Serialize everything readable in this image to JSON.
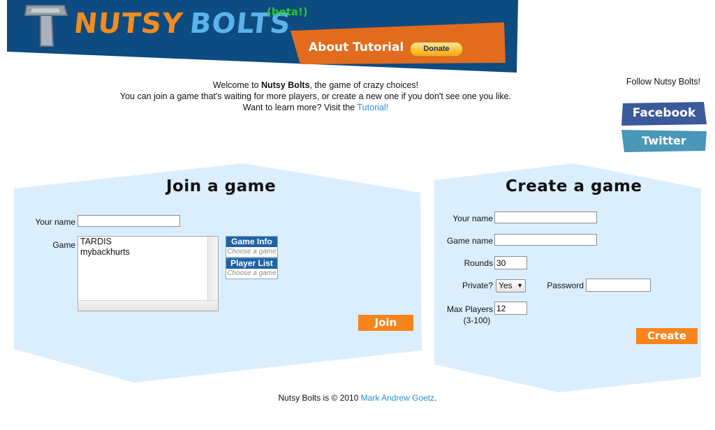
{
  "header": {
    "logo_word1": "NUTSY",
    "logo_word2": "BOLTS",
    "beta": "(beta!)",
    "about": "About",
    "tutorial": "Tutorial",
    "donate": "Donate",
    "colors": {
      "banner": "#0d4b80",
      "orange": "#e26b1d",
      "logo_orange": "#f28c1f",
      "logo_blue": "#5ab3ea"
    }
  },
  "intro": {
    "welcome_prefix": "Welcome to ",
    "brand": "Nutsy Bolts",
    "welcome_suffix": ", the game of crazy choices!",
    "line2": "You can join a game that's waiting for more players, or create a new one if you don't see one you like.",
    "line3_prefix": "Want to learn more? Visit the ",
    "tutorial_link": "Tutorial!"
  },
  "follow": {
    "label": "Follow Nutsy Bolts!",
    "facebook": "Facebook",
    "twitter": "Twitter"
  },
  "join": {
    "title": "Join a game",
    "name_label": "Your name",
    "name_value": "",
    "game_label": "Game",
    "games": [
      "TARDIS",
      "mybackhurts"
    ],
    "game_info_label": "Game Info",
    "game_info_hint": "Choose a game",
    "player_list_label": "Player List",
    "player_list_hint": "Choose a game",
    "join_button": "Join"
  },
  "create": {
    "title": "Create a game",
    "name_label": "Your name",
    "name_value": "",
    "game_name_label": "Game name",
    "game_name_value": "",
    "rounds_label": "Rounds",
    "rounds_value": "30",
    "private_label": "Private?",
    "private_value": "Yes",
    "password_label": "Password",
    "password_value": "",
    "max_players_label": "Max Players",
    "max_players_range": "(3-100)",
    "max_players_value": "12",
    "create_button": "Create"
  },
  "footer": {
    "prefix": "Nutsy Bolts is © 2010 ",
    "author": "Mark Andrew Goetz",
    "suffix": "."
  }
}
